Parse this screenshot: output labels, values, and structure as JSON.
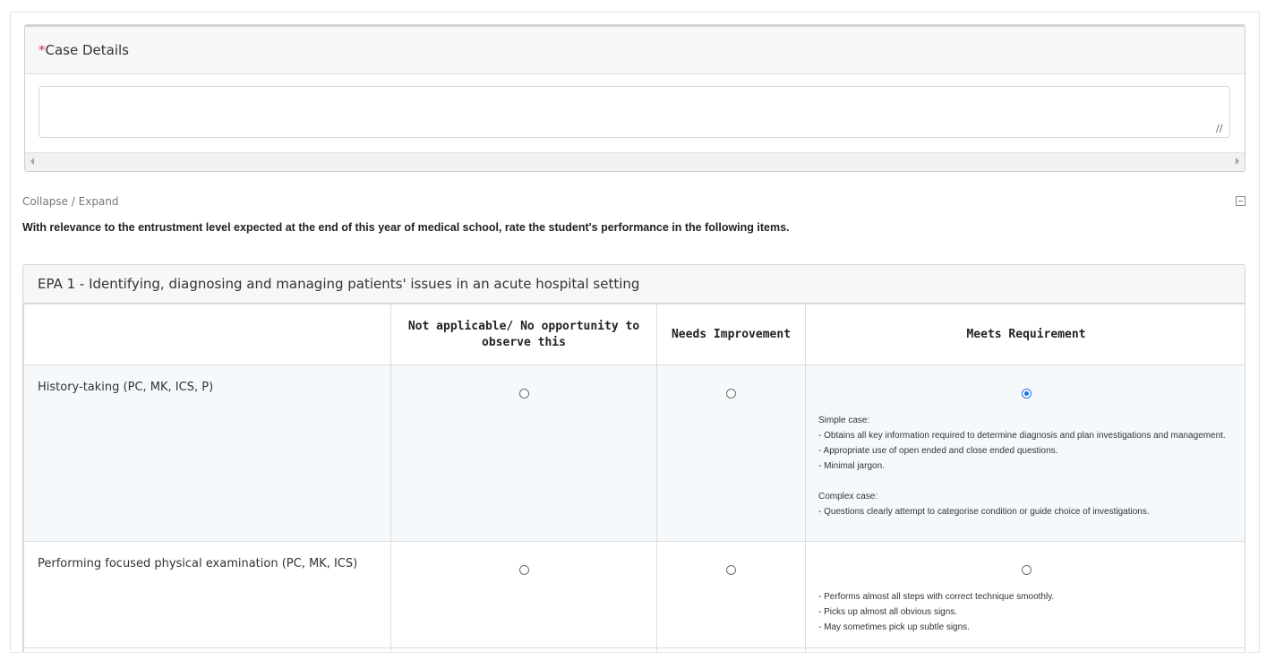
{
  "case_details": {
    "required_mark": "*",
    "label": "Case Details",
    "value": "",
    "placeholder": ""
  },
  "collapse_label": "Collapse / Expand",
  "instruction": "With relevance to the entrustment level expected at the end of this year of medical school, rate the student's performance in the following items.",
  "epa": {
    "title": "EPA 1 - Identifying, diagnosing and managing patients' issues in an acute hospital setting",
    "columns": [
      "",
      "Not applicable/ No opportunity to observe this",
      "Needs Improvement",
      "Meets Requirement"
    ],
    "rows": [
      {
        "label": "History-taking (PC, MK, ICS, P)",
        "selected": "Meets Requirement",
        "description": [
          "Simple case:",
          "- Obtains all key information required to determine diagnosis and plan investigations and management.",
          "- Appropriate use of open ended and close ended questions.",
          "- Minimal jargon.",
          "",
          "Complex case:",
          "- Questions clearly attempt to categorise condition or guide choice of investigations."
        ]
      },
      {
        "label": "Performing focused physical examination (PC, MK, ICS)",
        "selected": "",
        "description": [
          "- Performs almost all steps with correct technique smoothly.",
          "- Picks up almost all obvious signs.",
          "- May sometimes pick up subtle signs."
        ]
      }
    ]
  },
  "colors": {
    "required": "#d9314d",
    "radio_checked": "#1a73e8",
    "selected_row_bg": "#f5f9fc"
  }
}
